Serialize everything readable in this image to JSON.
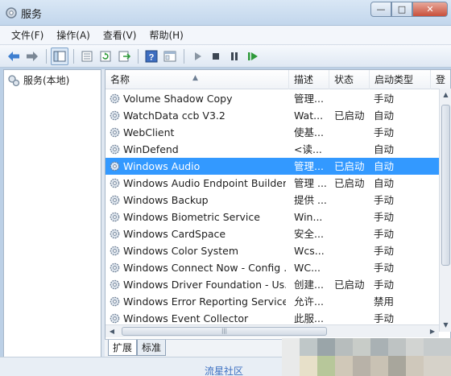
{
  "window": {
    "title": "服务",
    "controls": {
      "minimize": "—",
      "maximize": "□",
      "close": "✕"
    }
  },
  "menu": [
    "文件(F)",
    "操作(A)",
    "查看(V)",
    "帮助(H)"
  ],
  "toolbar": {
    "icons": [
      "back-arrow-icon",
      "forward-arrow-icon",
      "show-hide-tree-icon",
      "properties-icon",
      "refresh-icon",
      "export-list-icon",
      "help-icon",
      "console-icon",
      "start-service-icon",
      "stop-service-icon",
      "pause-service-icon",
      "restart-service-icon"
    ]
  },
  "left_pane": {
    "tree_label": "服务(本地)"
  },
  "table": {
    "columns": [
      "名称",
      "描述",
      "状态",
      "启动类型",
      "登"
    ],
    "rows": [
      {
        "name": "Volume Shadow Copy",
        "desc": "管理...",
        "status": "",
        "start": "手动",
        "selected": false
      },
      {
        "name": "WatchData ccb V3.2",
        "desc": "Wat...",
        "status": "已启动",
        "start": "自动",
        "selected": false
      },
      {
        "name": "WebClient",
        "desc": "使基...",
        "status": "",
        "start": "手动",
        "selected": false
      },
      {
        "name": "WinDefend",
        "desc": "<读...",
        "status": "",
        "start": "自动",
        "selected": false
      },
      {
        "name": "Windows Audio",
        "desc": "管理...",
        "status": "已启动",
        "start": "自动",
        "selected": true
      },
      {
        "name": "Windows Audio Endpoint Builder",
        "desc": "管理 ...",
        "status": "已启动",
        "start": "自动",
        "selected": false
      },
      {
        "name": "Windows Backup",
        "desc": "提供 ...",
        "status": "",
        "start": "手动",
        "selected": false
      },
      {
        "name": "Windows Biometric Service",
        "desc": "Win...",
        "status": "",
        "start": "手动",
        "selected": false
      },
      {
        "name": "Windows CardSpace",
        "desc": "安全...",
        "status": "",
        "start": "手动",
        "selected": false
      },
      {
        "name": "Windows Color System",
        "desc": "Wcs...",
        "status": "",
        "start": "手动",
        "selected": false
      },
      {
        "name": "Windows Connect Now - Config ...",
        "desc": "WC...",
        "status": "",
        "start": "手动",
        "selected": false
      },
      {
        "name": "Windows Driver Foundation - Us...",
        "desc": "创建...",
        "status": "已启动",
        "start": "手动",
        "selected": false
      },
      {
        "name": "Windows Error Reporting Service",
        "desc": "允许...",
        "status": "",
        "start": "禁用",
        "selected": false
      },
      {
        "name": "Windows Event Collector",
        "desc": "此服...",
        "status": "",
        "start": "手动",
        "selected": false
      }
    ]
  },
  "tabs": [
    "扩展",
    "标准"
  ],
  "footer": {
    "watermark": "流星社区"
  },
  "colors": {
    "selected_row": "#3399ff",
    "title_bar": "#c9dbef"
  }
}
